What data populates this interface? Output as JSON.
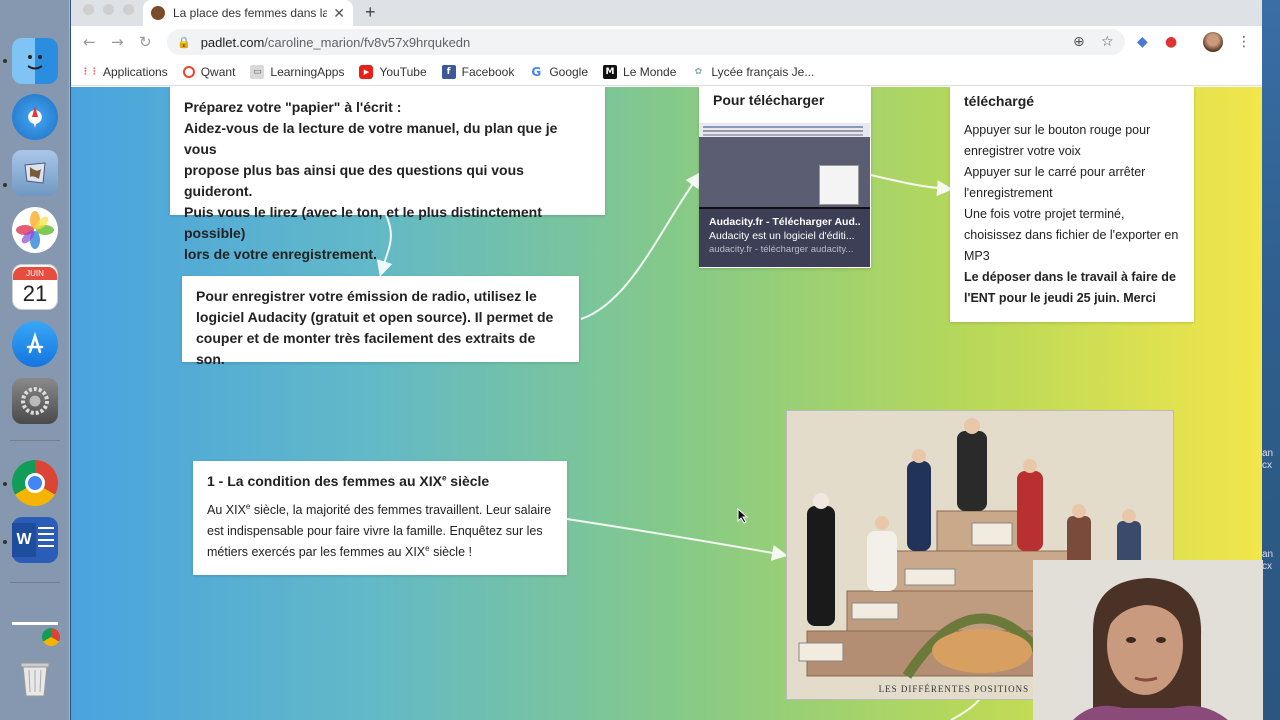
{
  "browser": {
    "tab_title": "La place des femmes dans la s",
    "url_host": "padlet.com",
    "url_path": "/caroline_marion/fv8v57x9hrqukedn"
  },
  "bookmarks": [
    {
      "label": "Applications",
      "icon": "apps-grid-icon"
    },
    {
      "label": "Qwant",
      "icon": "qwant-icon"
    },
    {
      "label": "LearningApps",
      "icon": "learningapps-icon"
    },
    {
      "label": "YouTube",
      "icon": "youtube-icon"
    },
    {
      "label": "Facebook",
      "icon": "facebook-icon"
    },
    {
      "label": "Google",
      "icon": "google-icon"
    },
    {
      "label": "Le Monde",
      "icon": "lemonde-icon"
    },
    {
      "label": "Lycée français Je...",
      "icon": "lycee-icon"
    }
  ],
  "cards": {
    "prepare": {
      "title_lines": [
        "Préparez votre \"papier\" à l'écrit :",
        "Aidez-vous de la lecture de votre manuel, du plan que je vous",
        "propose plus bas ainsi que des questions qui vous guideront.",
        "Puis vous le lirez (avec le ton, et le plus distinctement possible)",
        "lors de votre enregistrement."
      ]
    },
    "audacity": {
      "lines": [
        "Pour enregistrer votre émission de radio, utilisez le",
        "logiciel Audacity (gratuit et open source). Il permet de",
        "couper et de monter très facilement des extraits de son."
      ]
    },
    "download": {
      "title": "Pour télécharger",
      "link_title": "Audacity.fr - Télécharger Aud...",
      "link_desc": "Audacity est un logiciel d'éditi...",
      "link_url": "audacity.fr - télécharger audacity..."
    },
    "instructions": {
      "title": "téléchargé",
      "lines": [
        "Appuyer sur le bouton rouge pour",
        "enregistrer votre voix",
        "Appuyer sur le carré pour arrêter",
        "l'enregistrement",
        "Une fois votre projet terminé,",
        "choisissez dans fichier de l'exporter en",
        "MP3"
      ],
      "bold_lines": [
        "Le déposer dans le travail à faire de",
        "l'ENT pour le jeudi 25 juin. Merci"
      ]
    },
    "condition": {
      "title_pre": "1 - La condition des femmes au XIX",
      "title_sup": "e",
      "title_post": " siècle",
      "body_1a": "Au XIX",
      "body_1sup": "e",
      "body_1b": " siècle, la majorité des femmes travaillent. Leur salaire",
      "body_2": "est indispensable pour faire vivre la famille. Enquêtez sur les",
      "body_3a": "métiers exercés par les femmes au XIX",
      "body_3sup": "e",
      "body_3b": " siècle !"
    },
    "illustration": {
      "caption": "LES DIFFÉRENTES POSITIONS SOCIALES"
    }
  },
  "dock": {
    "calendar_month": "JUIN",
    "calendar_day": "21"
  },
  "desktop": {
    "side_text_1": "an",
    "side_text_2": "cx"
  }
}
